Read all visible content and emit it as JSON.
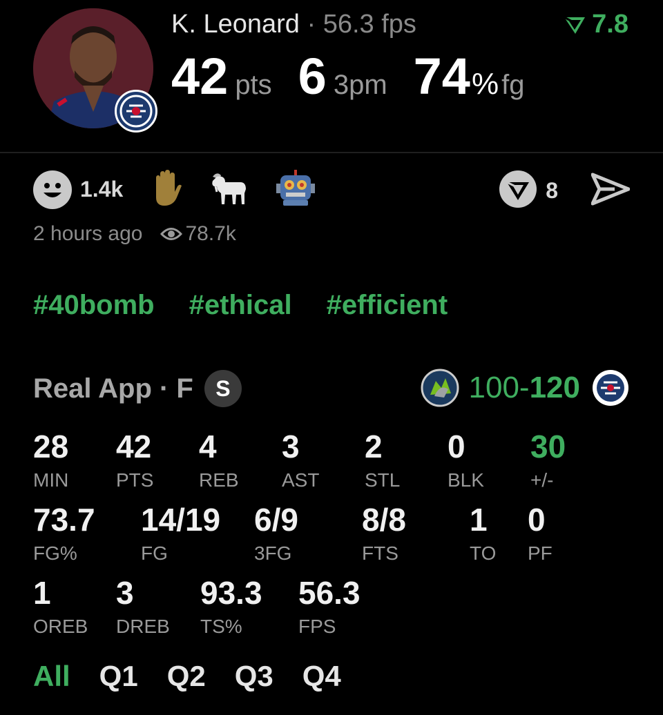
{
  "header": {
    "player_name": "K. Leonard",
    "separator": " · ",
    "fps_text": "56.3 fps",
    "rating": "7.8",
    "big_stats": [
      {
        "value": "42",
        "unit": "pts"
      },
      {
        "value": "6",
        "unit": "3pm"
      },
      {
        "value": "74",
        "pct": "%",
        "unit": "fg"
      }
    ]
  },
  "reactions": {
    "smiley_count": "1.4k",
    "emojis": [
      "raised-hand-icon",
      "goat-icon",
      "robot-icon"
    ],
    "comment_count": "8"
  },
  "meta": {
    "time_ago": "2 hours ago",
    "views": "78.7k"
  },
  "tags": [
    "#40bomb",
    "#ethical",
    "#efficient"
  ],
  "game": {
    "app_label": "Real App · F",
    "badge": "S",
    "score_opponent": "100-",
    "score_team": "120"
  },
  "stats": {
    "row1": [
      {
        "value": "28",
        "label": "MIN"
      },
      {
        "value": "42",
        "label": "PTS"
      },
      {
        "value": "4",
        "label": "REB"
      },
      {
        "value": "3",
        "label": "AST"
      },
      {
        "value": "2",
        "label": "STL"
      },
      {
        "value": "0",
        "label": "BLK"
      },
      {
        "value": "30",
        "label": "+/-"
      }
    ],
    "row2": [
      {
        "value": "73.7",
        "label": "FG%"
      },
      {
        "value": "14/19",
        "label": "FG"
      },
      {
        "value": "6/9",
        "label": "3FG"
      },
      {
        "value": "8/8",
        "label": "FTS"
      },
      {
        "value": "1",
        "label": "TO"
      },
      {
        "value": "0",
        "label": "PF"
      }
    ],
    "row3": [
      {
        "value": "1",
        "label": "OREB"
      },
      {
        "value": "3",
        "label": "DREB"
      },
      {
        "value": "93.3",
        "label": "TS%"
      },
      {
        "value": "56.3",
        "label": "FPS"
      }
    ]
  },
  "quarters": [
    "All",
    "Q1",
    "Q2",
    "Q3",
    "Q4"
  ],
  "colors": {
    "accent": "#3fae5f",
    "background": "#000000",
    "muted": "#9a9a9a"
  }
}
